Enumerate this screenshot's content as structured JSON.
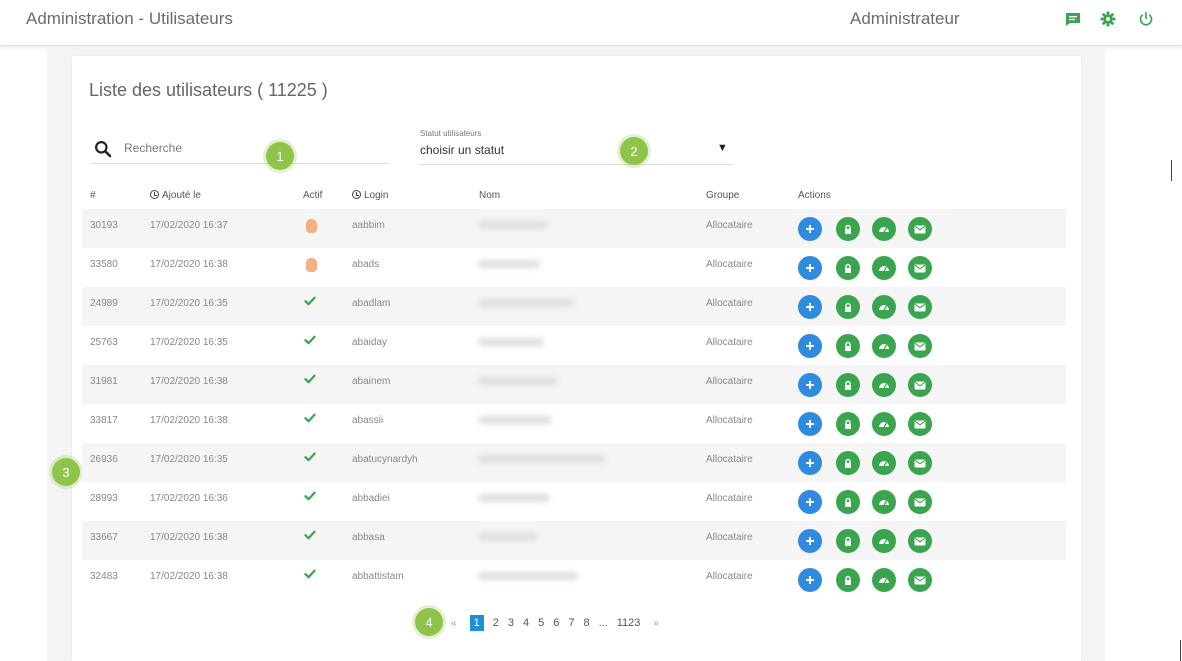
{
  "header": {
    "title": "Administration - Utilisateurs",
    "user_role": "Administrateur",
    "icons": [
      "chat-icon",
      "gear-icon",
      "power-icon"
    ],
    "accent_color": "#3aa44f"
  },
  "list": {
    "title": "Liste des utilisateurs ( 11225 )",
    "search_placeholder": "Recherche",
    "status_label": "Statut utilisateurs",
    "status_value": "choisir un statut"
  },
  "badges": [
    "1",
    "2",
    "3",
    "4"
  ],
  "table": {
    "columns": [
      "#",
      "Ajouté le",
      "Actif",
      "Login",
      "Nom",
      "Groupe",
      "Actions"
    ],
    "rows": [
      {
        "id": "30193",
        "date": "17/02/2020 16:37",
        "active": "pending",
        "login": "aabbim",
        "group": "Allocataire"
      },
      {
        "id": "33580",
        "date": "17/02/2020 16:38",
        "active": "pending",
        "login": "abads",
        "group": "Allocataire"
      },
      {
        "id": "24989",
        "date": "17/02/2020 16:35",
        "active": "yes",
        "login": "abadlam",
        "group": "Allocataire"
      },
      {
        "id": "25763",
        "date": "17/02/2020 16:35",
        "active": "yes",
        "login": "abaiday",
        "group": "Allocataire"
      },
      {
        "id": "31981",
        "date": "17/02/2020 16:38",
        "active": "yes",
        "login": "abainem",
        "group": "Allocataire"
      },
      {
        "id": "33817",
        "date": "17/02/2020 16:38",
        "active": "yes",
        "login": "abassii",
        "group": "Allocataire"
      },
      {
        "id": "26936",
        "date": "17/02/2020 16:35",
        "active": "yes",
        "login": "abatucynardyh",
        "group": "Allocataire"
      },
      {
        "id": "28993",
        "date": "17/02/2020 16:36",
        "active": "yes",
        "login": "abbadiei",
        "group": "Allocataire"
      },
      {
        "id": "33667",
        "date": "17/02/2020 16:38",
        "active": "yes",
        "login": "abbasa",
        "group": "Allocataire"
      },
      {
        "id": "32483",
        "date": "17/02/2020 16:38",
        "active": "yes",
        "login": "abbattistam",
        "group": "Allocataire"
      }
    ],
    "action_icons": [
      "plus-icon",
      "lock-icon",
      "dashboard-icon",
      "mail-icon"
    ]
  },
  "pagination": {
    "prev": "«",
    "pages": [
      "1",
      "2",
      "3",
      "4",
      "5",
      "6",
      "7",
      "8",
      "...",
      "1123"
    ],
    "current": "1",
    "next": "»"
  }
}
